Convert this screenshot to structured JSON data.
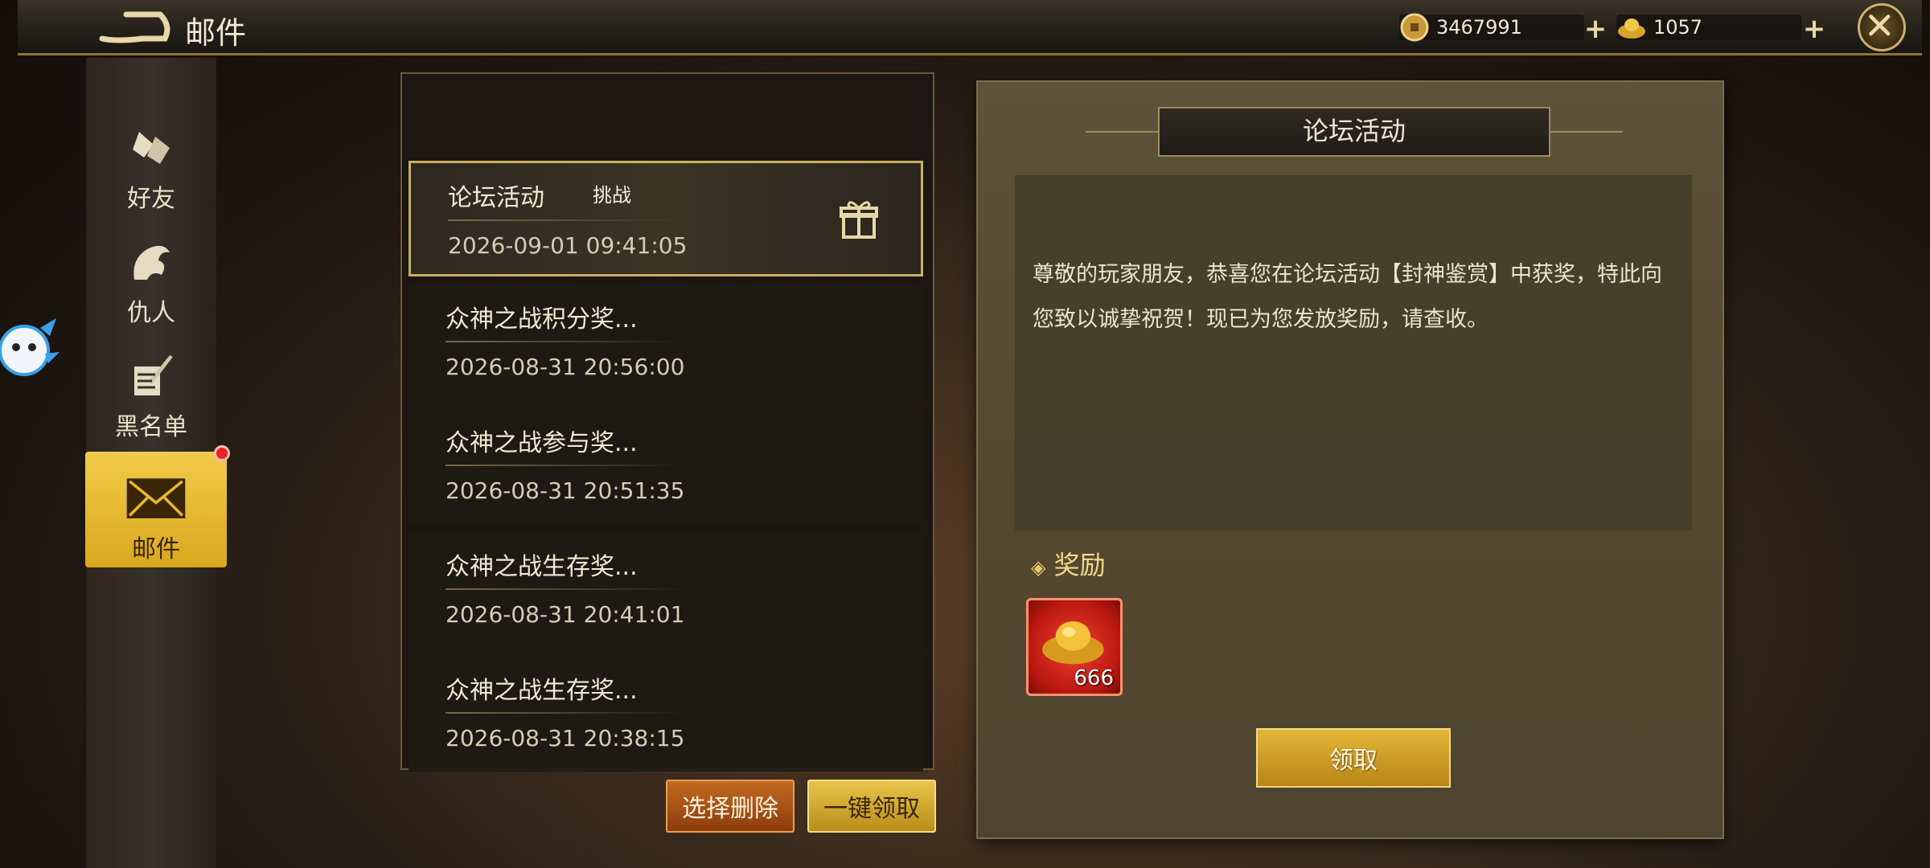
{
  "header": {
    "title": "邮件",
    "coins": "3467991",
    "ingots": "1057"
  },
  "sidebar": {
    "items": [
      {
        "label": "好友"
      },
      {
        "label": "仇人"
      },
      {
        "label": "黑名单"
      },
      {
        "label": "邮件"
      }
    ]
  },
  "mail_list": {
    "items": [
      {
        "subject": "论坛活动",
        "tag": "挑战",
        "date": "2026-09-01   09:41:05"
      },
      {
        "subject": "众神之战积分奖...",
        "date": "2026-08-31   20:56:00"
      },
      {
        "subject": "众神之战参与奖...",
        "date": "2026-08-31   20:51:35"
      },
      {
        "subject": "众神之战生存奖...",
        "date": "2026-08-31   20:41:01"
      },
      {
        "subject": "众神之战生存奖...",
        "date": "2026-08-31   20:38:15"
      }
    ],
    "delete_label": "选择删除",
    "claim_all_label": "一键领取"
  },
  "detail": {
    "title": "论坛活动",
    "body": "尊敬的玩家朋友，恭喜您在论坛活动【封神鉴赏】中获奖，特此向您致以诚挚祝贺！现已为您发放奖励，请查收。",
    "reward_heading": "奖励",
    "reward_qty": "666",
    "claim_label": "领取"
  }
}
